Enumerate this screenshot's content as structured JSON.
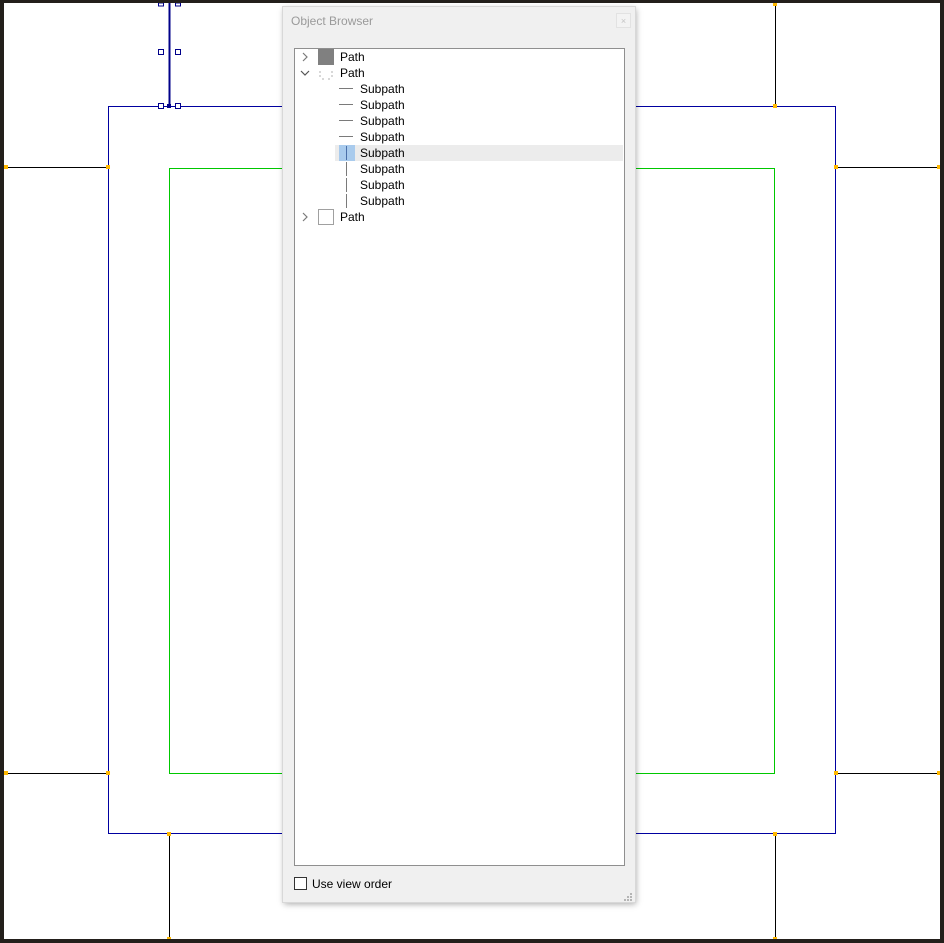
{
  "panel": {
    "title": "Object Browser",
    "close_glyph": "×",
    "tree": [
      {
        "label": "Path",
        "thumbnail": "filled-gray-square",
        "expanded": false
      },
      {
        "label": "Path",
        "thumbnail": "dashed-outline",
        "expanded": true,
        "children": [
          {
            "label": "Subpath",
            "orientation": "horizontal"
          },
          {
            "label": "Subpath",
            "orientation": "horizontal"
          },
          {
            "label": "Subpath",
            "orientation": "horizontal"
          },
          {
            "label": "Subpath",
            "orientation": "horizontal"
          },
          {
            "label": "Subpath",
            "orientation": "vertical",
            "selected": true
          },
          {
            "label": "Subpath",
            "orientation": "vertical"
          },
          {
            "label": "Subpath",
            "orientation": "vertical"
          },
          {
            "label": "Subpath",
            "orientation": "vertical"
          }
        ]
      },
      {
        "label": "Path",
        "thumbnail": "outline-square",
        "expanded": false
      }
    ],
    "use_view_order": {
      "label": "Use view order",
      "checked": false
    }
  },
  "colors": {
    "background": "#231f1b",
    "canvas": "#ffffff",
    "outer_path": "#0000a0",
    "inner_path": "#00c800",
    "connector": "#000000",
    "node_handle": "#ffb800",
    "selection_highlight": "#a9cbed"
  }
}
